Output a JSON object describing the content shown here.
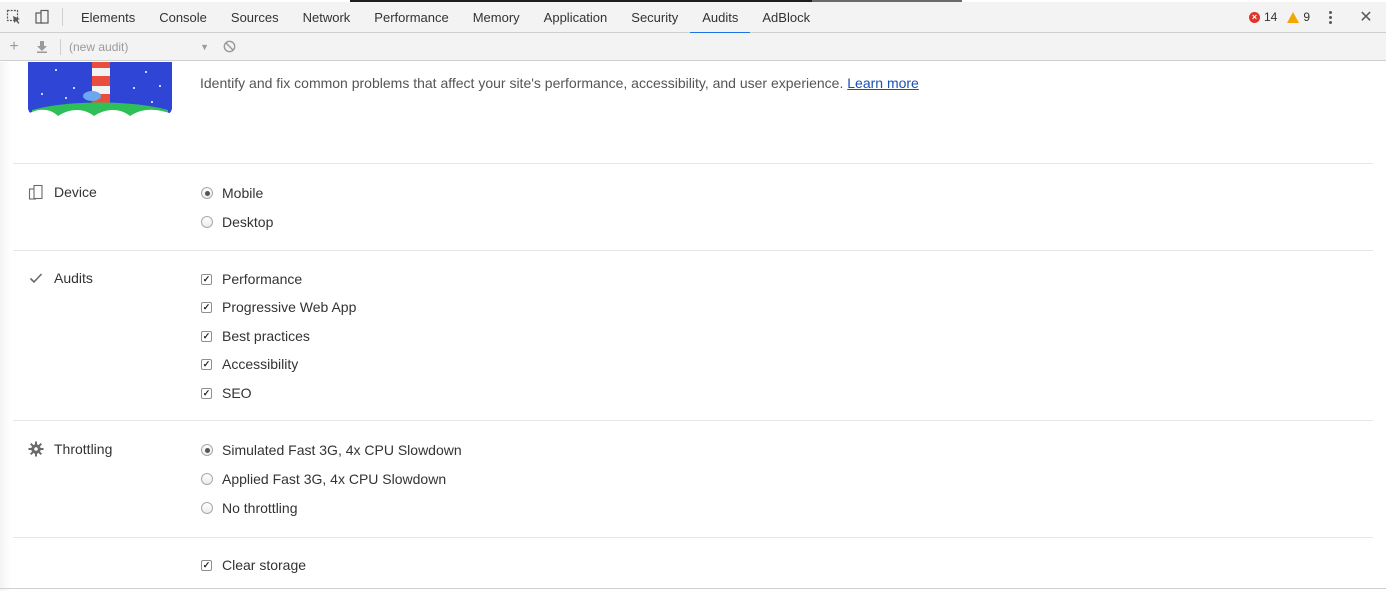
{
  "tabs": [
    {
      "label": "Elements"
    },
    {
      "label": "Console"
    },
    {
      "label": "Sources"
    },
    {
      "label": "Network"
    },
    {
      "label": "Performance"
    },
    {
      "label": "Memory"
    },
    {
      "label": "Application"
    },
    {
      "label": "Security"
    },
    {
      "label": "Audits",
      "active": true
    },
    {
      "label": "AdBlock"
    }
  ],
  "counters": {
    "errors": "14",
    "warnings": "9"
  },
  "toolbar": {
    "audit_select": "(new audit)"
  },
  "intro": {
    "text": "Identify and fix common problems that affect your site's performance, accessibility, and user experience. ",
    "link": "Learn more"
  },
  "device": {
    "label": "Device",
    "options": [
      {
        "label": "Mobile",
        "selected": true
      },
      {
        "label": "Desktop",
        "selected": false
      }
    ]
  },
  "audits": {
    "label": "Audits",
    "options": [
      {
        "label": "Performance",
        "checked": true
      },
      {
        "label": "Progressive Web App",
        "checked": true
      },
      {
        "label": "Best practices",
        "checked": true
      },
      {
        "label": "Accessibility",
        "checked": true
      },
      {
        "label": "SEO",
        "checked": true
      }
    ]
  },
  "throttling": {
    "label": "Throttling",
    "options": [
      {
        "label": "Simulated Fast 3G, 4x CPU Slowdown",
        "selected": true
      },
      {
        "label": "Applied Fast 3G, 4x CPU Slowdown",
        "selected": false
      },
      {
        "label": "No throttling",
        "selected": false
      }
    ]
  },
  "storage": {
    "options": [
      {
        "label": "Clear storage",
        "checked": true
      }
    ]
  },
  "colors": {
    "accent": "#1a73e8",
    "link": "#1a4fb5",
    "error": "#e0352b",
    "warning": "#f2a600"
  }
}
